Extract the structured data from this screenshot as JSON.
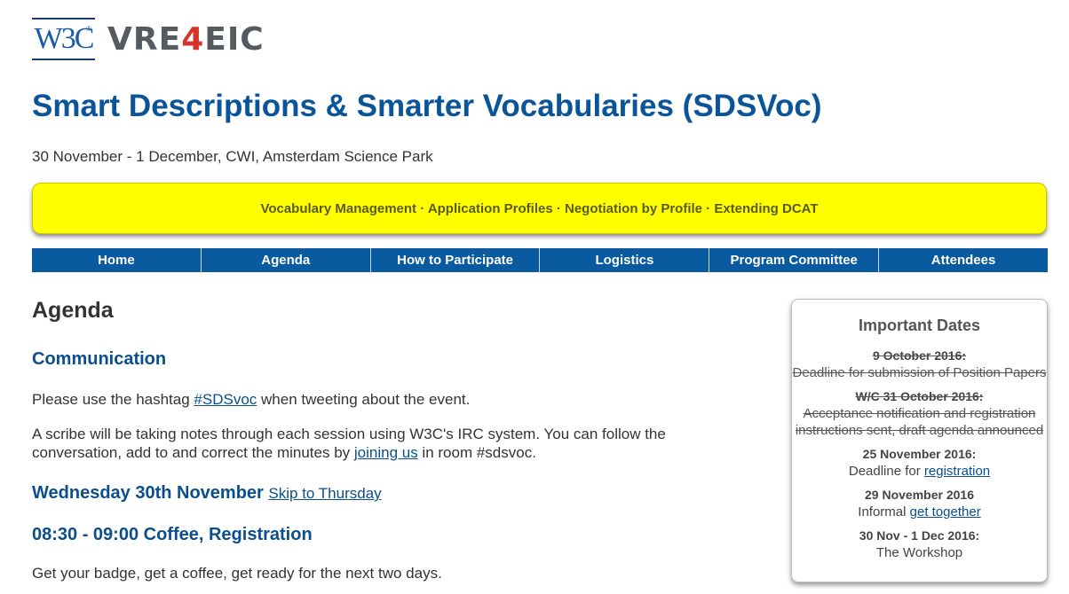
{
  "logos": {
    "w3c": "W3C",
    "w3c_mark": "®",
    "vre_pre": "VRE",
    "vre_four": "4",
    "vre_post": "EIC"
  },
  "title": "Smart Descriptions & Smarter Vocabularies (SDSVoc)",
  "subtitle": "30 November - 1 December, CWI, Amsterdam Science Park",
  "banner": "Vocabulary Management · Application Profiles · Negotiation by Profile · Extending DCAT",
  "nav": [
    "Home",
    "Agenda",
    "How to Participate",
    "Logistics",
    "Program Committee",
    "Attendees"
  ],
  "main": {
    "heading": "Agenda",
    "communication_heading": "Communication",
    "p1_pre": "Please use the hashtag ",
    "p1_link": "#SDSvoc",
    "p1_post": " when tweeting about the event.",
    "p2_pre": "A scribe will be taking notes through each session using W3C's IRC system. You can follow the conversation, add to and correct the minutes by ",
    "p2_link": "joining us",
    "p2_post": " in room #sdsvoc.",
    "wed_heading": "Wednesday 30th November",
    "skip_link": "Skip to Thursday",
    "coffee_heading": "08:30 - 09:00 Coffee, Registration",
    "p3": "Get your badge, get a coffee, get ready for the next two days."
  },
  "dates": {
    "heading": "Important Dates",
    "items": [
      {
        "date": "9 October 2016:",
        "desc": "Deadline for submission of Position Papers"
      },
      {
        "date": "W/C 31 October 2016:",
        "desc": "Acceptance notification and registration instructions sent, draft agenda announced"
      },
      {
        "date": "25 November 2016:",
        "desc_pre": "Deadline for ",
        "desc_link": "registration"
      },
      {
        "date": "29 November 2016",
        "desc_pre": "Informal ",
        "desc_link": "get together"
      },
      {
        "date": "30 Nov - 1 Dec 2016:",
        "desc": "The Workshop"
      }
    ]
  }
}
